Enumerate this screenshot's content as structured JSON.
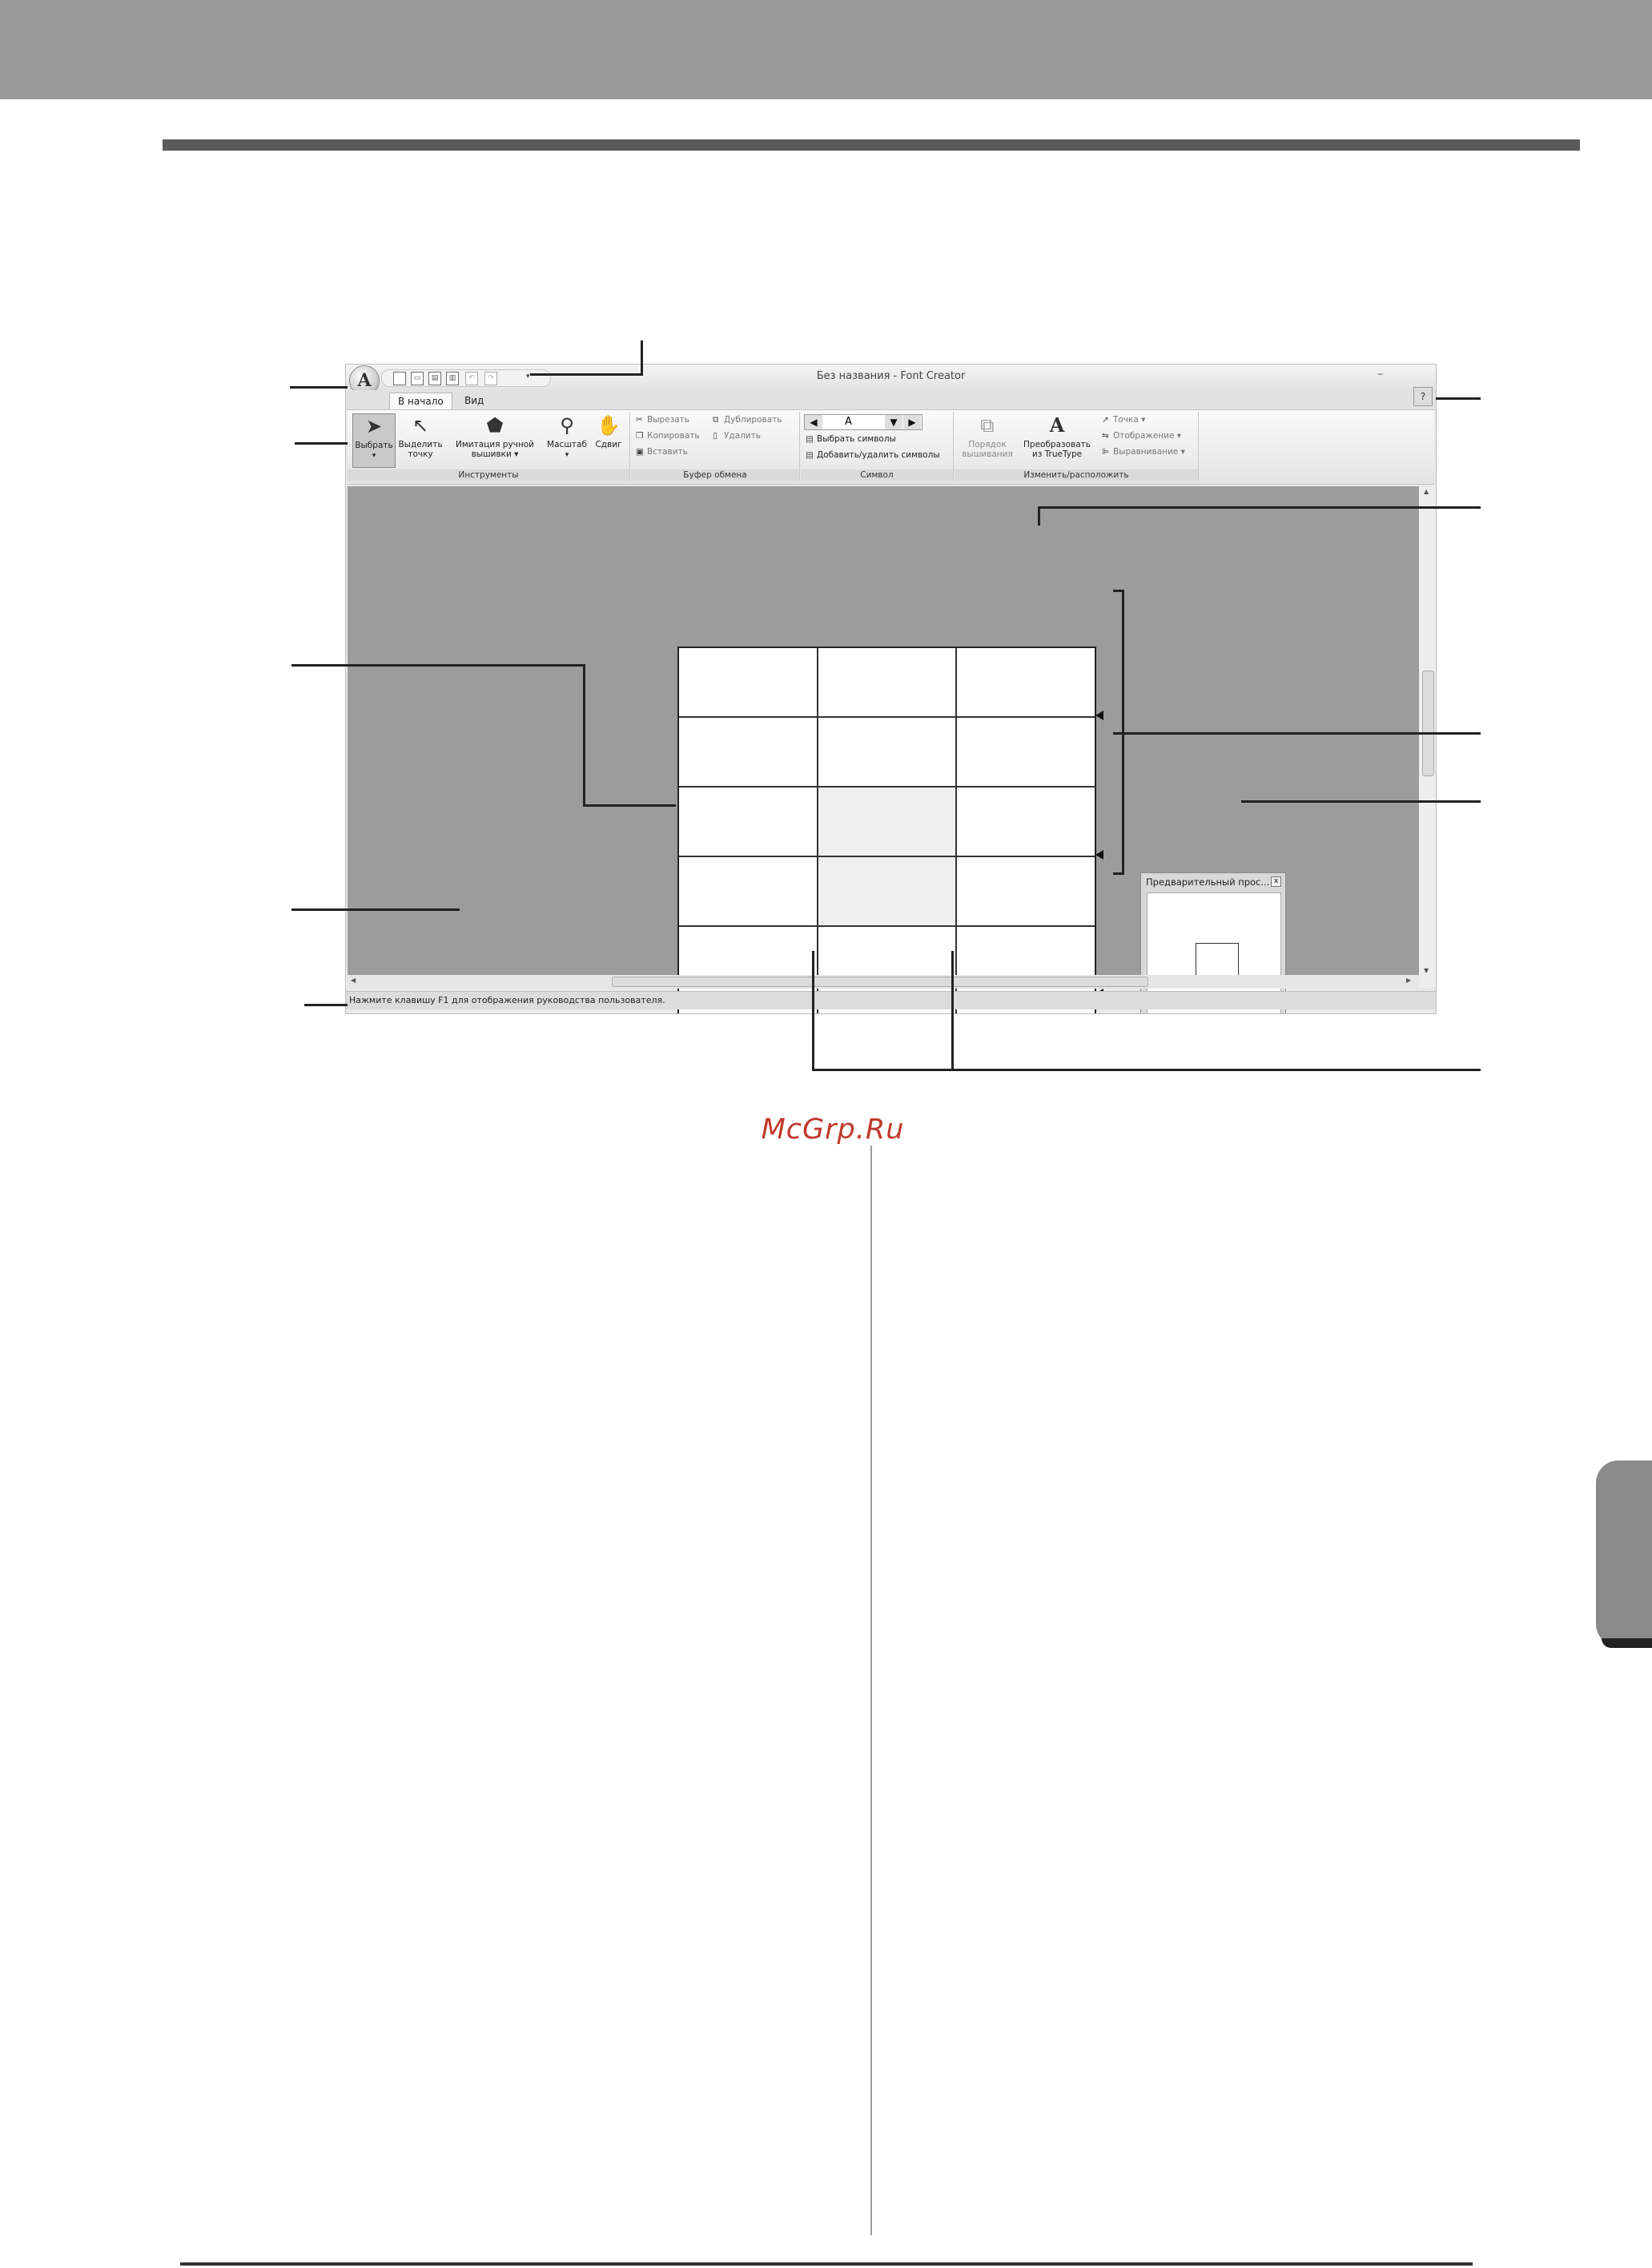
{
  "window": {
    "title": "Без названия - Font Creator",
    "app_button": "A",
    "minimize": "–",
    "help_button": "?"
  },
  "tabs": [
    {
      "label": "В начало"
    },
    {
      "label": "Вид"
    }
  ],
  "ribbon": {
    "tools": {
      "group_label": "Инструменты",
      "select": "Выбрать",
      "select_point_line1": "Выделить",
      "select_point_line2": "точку",
      "hand_embroidery_line1": "Имитация ручной",
      "hand_embroidery_line2": "вышивки ▾",
      "zoom": "Масштаб",
      "pan": "Сдвиг"
    },
    "clipboard": {
      "group_label": "Буфер обмена",
      "cut": "Вырезать",
      "copy": "Копировать",
      "paste": "Вставить",
      "duplicate": "Дублировать",
      "delete": "Удалить"
    },
    "character": {
      "group_label": "Символ",
      "current_char": "A",
      "select_chars": "Выбрать символы",
      "add_remove_chars": "Добавить/удалить символы"
    },
    "modify": {
      "group_label": "Изменить/расположить",
      "sew_order_line1": "Порядок",
      "sew_order_line2": "вышивания",
      "convert_line1": "Преобразовать",
      "convert_line2": "из TrueType",
      "point": "Точка ▾",
      "mirror": "Отображение ▾",
      "align": "Выравнивание ▾"
    }
  },
  "preview": {
    "title": "Предварительный прос...",
    "close": "x"
  },
  "statusbar": {
    "text": "Нажмите клавишу F1 для отображения руководства пользователя."
  },
  "watermark": "McGrp.Ru"
}
